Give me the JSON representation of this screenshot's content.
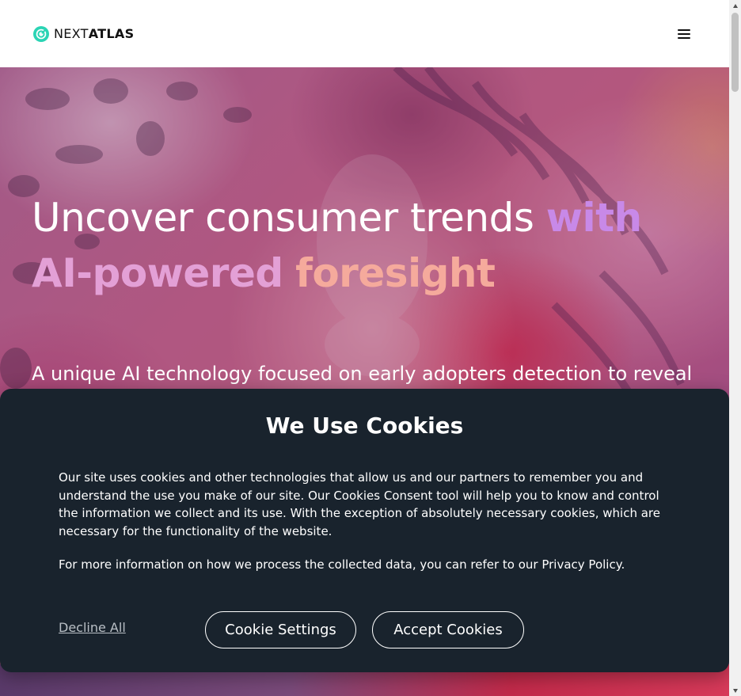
{
  "header": {
    "logo_prefix": "NEXT",
    "logo_suffix": "ATLAS",
    "menu_icon": "hamburger-menu-icon",
    "logo_icon": "nextatlas-logo-icon"
  },
  "hero": {
    "title_part1": "Uncover consumer trends ",
    "title_hl1": "with",
    "title_hl2": "AI-powered",
    "title_hl3": "foresight",
    "subtitle": "A unique AI technology focused on early adopters detection to reveal"
  },
  "cookie_banner": {
    "title": "We Use Cookies",
    "paragraph1": "Our site uses cookies and other technologies that allow us and our partners to remember you and understand the use you make of our site. Our Cookies Consent tool will help you to know and control the information we collect and its use. With the exception of absolutely necessary cookies, which are necessary for the functionality of the website.",
    "paragraph2": "For more information on how we process the collected data, you can refer to our Privacy Policy.",
    "decline_label": "Decline All",
    "settings_label": "Cookie Settings",
    "accept_label": "Accept Cookies"
  },
  "colors": {
    "logo_teal": "#2ad4b4",
    "highlight_purple": "#c889e8",
    "highlight_pink": "#e3a0d6",
    "highlight_peach": "#f5aa9c",
    "banner_bg": "#19232d"
  }
}
